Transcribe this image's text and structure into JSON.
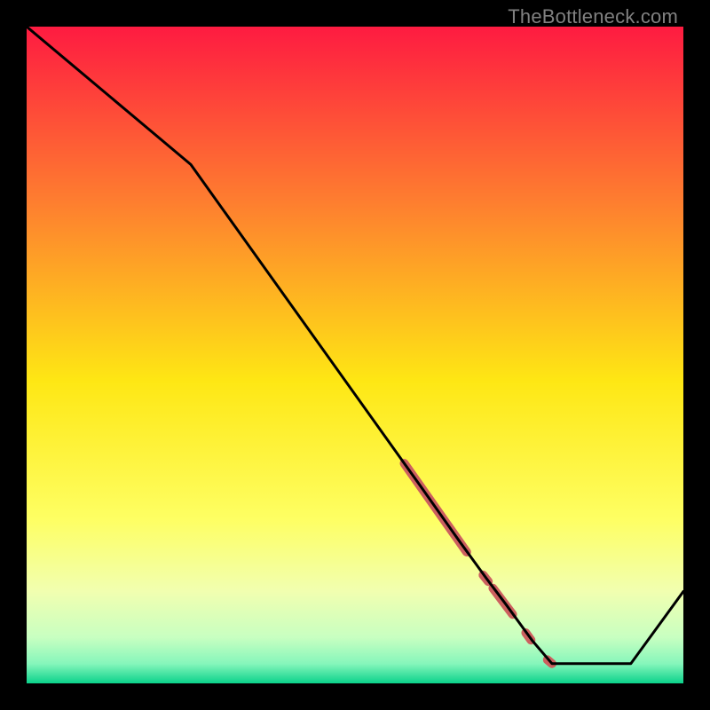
{
  "watermark": "TheBottleneck.com",
  "colors": {
    "top": "#fe1b41",
    "q1": "#fe7f2f",
    "mid": "#fee714",
    "q3a": "#feff63",
    "q3b": "#f1ffb0",
    "q3c": "#c8ffc1",
    "q3d": "#86f6bb",
    "bottom": "#0bd28b",
    "line": "#000000",
    "marker": "#cc605f",
    "frame": "#000000"
  },
  "chart_data": {
    "type": "line",
    "title": "",
    "xlabel": "",
    "ylabel": "",
    "xlim": [
      0,
      100
    ],
    "ylim": [
      0,
      100
    ],
    "x": [
      0,
      25,
      60,
      66,
      70,
      73,
      77,
      80,
      92,
      100
    ],
    "values": [
      100,
      79,
      30,
      21.5,
      16,
      12,
      6.5,
      3,
      3,
      14
    ],
    "markers": [
      {
        "x0": 57.5,
        "y0": 33.5,
        "x1": 67.0,
        "y1": 20.0,
        "w": 10
      },
      {
        "x0": 69.5,
        "y0": 16.5,
        "x1": 70.3,
        "y1": 15.5,
        "w": 10
      },
      {
        "x0": 71.0,
        "y0": 14.5,
        "x1": 74.0,
        "y1": 10.5,
        "w": 10
      },
      {
        "x0": 76.0,
        "y0": 7.7,
        "x1": 76.8,
        "y1": 6.6,
        "w": 10
      },
      {
        "x0": 79.3,
        "y0": 3.6,
        "x1": 80.0,
        "y1": 3.0,
        "w": 10
      }
    ]
  }
}
